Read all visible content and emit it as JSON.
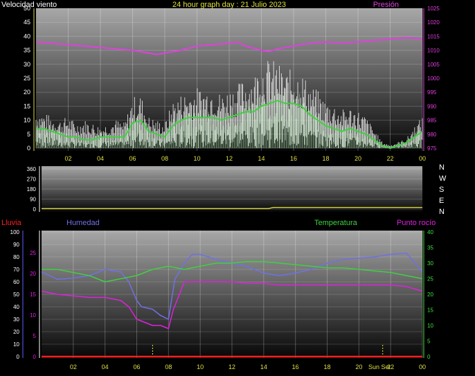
{
  "title": "24 hour graph day : 21 Julio 2023",
  "colors": {
    "background": "#000000",
    "wind_speed": "#ffffff",
    "wind_avg": "#40d040",
    "wind_low": "#c8ffc8",
    "pressure": "#e040e0",
    "direction": "#d0d040",
    "humidity": "#7070e8",
    "temperature": "#40d040",
    "dewpoint": "#e020e0",
    "rain": "#ff2020",
    "axis_yellow": "#e0e040",
    "axis_white": "#ffffff",
    "rain_axis": "#6060ff",
    "axis_green": "#40e040"
  },
  "chart_data": [
    {
      "type": "line",
      "name": "wind-pressure",
      "labels": {
        "left": "Velocidad viento",
        "right": "Presión"
      },
      "x_ticks": [
        "02",
        "04",
        "06",
        "08",
        "10",
        "12",
        "14",
        "16",
        "18",
        "20",
        "22",
        "00"
      ],
      "x_tick_hours": [
        2,
        4,
        6,
        8,
        10,
        12,
        14,
        16,
        18,
        20,
        22,
        24
      ],
      "y_left_ticks": [
        "50",
        "45",
        "40",
        "35",
        "30",
        "25",
        "20",
        "15",
        "10",
        "5",
        "0"
      ],
      "y_left_range": [
        0,
        50
      ],
      "y_right_ticks": [
        "1025",
        "1020",
        "1015",
        "1010",
        "1005",
        "1000",
        "995",
        "990",
        "985",
        "980",
        "975"
      ],
      "y_right_range": [
        975,
        1025
      ],
      "series": [
        {
          "key": "wind_gust",
          "color_key": "wind_speed",
          "x": [
            0,
            0.5,
            1,
            1.5,
            2,
            2.5,
            3,
            3.5,
            4,
            4.5,
            5,
            5.5,
            6,
            6.5,
            7,
            7.5,
            8,
            8.5,
            9,
            9.5,
            10,
            10.5,
            11,
            11.5,
            12,
            12.5,
            13,
            13.5,
            14,
            14.5,
            15,
            15.5,
            16,
            16.5,
            17,
            17.5,
            18,
            18.5,
            19,
            19.5,
            20,
            20.5,
            21,
            21.5,
            22,
            22.5,
            23,
            23.5,
            24
          ],
          "y": [
            12,
            11,
            10,
            9,
            10,
            8,
            9,
            8,
            7,
            8,
            9,
            8,
            16,
            17,
            10,
            9,
            8,
            15,
            17,
            18,
            19,
            19,
            20,
            17,
            19,
            20,
            22,
            23,
            27,
            28,
            27,
            24,
            25,
            24,
            20,
            18,
            15,
            14,
            12,
            13,
            12,
            10,
            6,
            2,
            1,
            2,
            3,
            7,
            10
          ]
        },
        {
          "key": "wind_avg",
          "color_key": "wind_avg",
          "x": [
            0,
            0.5,
            1,
            1.5,
            2,
            2.5,
            3,
            3.5,
            4,
            4.5,
            5,
            5.5,
            6,
            6.5,
            7,
            7.5,
            8,
            8.5,
            9,
            9.5,
            10,
            10.5,
            11,
            11.5,
            12,
            12.5,
            13,
            13.5,
            14,
            14.5,
            15,
            15.5,
            16,
            16.5,
            17,
            17.5,
            18,
            18.5,
            19,
            19.5,
            20,
            20.5,
            21,
            21.5,
            22,
            22.5,
            23,
            23.5,
            24
          ],
          "y": [
            7,
            7,
            6,
            5,
            4,
            4,
            3,
            3,
            4,
            4,
            4,
            4,
            9,
            10,
            6,
            5,
            4,
            8,
            10,
            11,
            11,
            11,
            11,
            10,
            11,
            12,
            13,
            13,
            15,
            16,
            17,
            16,
            16,
            15,
            12,
            10,
            8,
            7,
            6,
            7,
            6,
            5,
            3,
            1,
            0,
            1,
            2,
            4,
            6
          ]
        },
        {
          "key": "pressure",
          "color_key": "pressure",
          "x": [
            0,
            1,
            2,
            3,
            4,
            5,
            6,
            7,
            7.5,
            8,
            9,
            10,
            11,
            12,
            12.5,
            13,
            14,
            14.5,
            15,
            16,
            17,
            18,
            19,
            20,
            21,
            22,
            23,
            24
          ],
          "y": [
            1013,
            1012.5,
            1012,
            1011.5,
            1011,
            1010.5,
            1010,
            1009,
            1008.5,
            1009,
            1010,
            1011.5,
            1012,
            1012.5,
            1013,
            1011.5,
            1010,
            1009.5,
            1010.5,
            1011.5,
            1012.5,
            1013,
            1012.5,
            1013,
            1013.5,
            1014,
            1014.5,
            1014
          ]
        }
      ]
    },
    {
      "type": "line",
      "name": "wind-direction",
      "y_ticks": [
        "360",
        "270",
        "180",
        "90",
        "0"
      ],
      "y_range": [
        0,
        360
      ],
      "dir_labels": [
        "N",
        "W",
        "S",
        "E",
        "N"
      ],
      "series": [
        {
          "key": "direction",
          "color_key": "direction",
          "x": [
            0,
            14.3,
            14.6,
            24
          ],
          "y": [
            5,
            5,
            15,
            15
          ]
        }
      ]
    },
    {
      "type": "line",
      "name": "humidity-temperature",
      "labels": {
        "rain": "Lluvia",
        "humidity": "Humedad",
        "temperature": "Temperatura",
        "dewpoint": "Punto rocío"
      },
      "x_ticks": [
        "02",
        "04",
        "06",
        "08",
        "10",
        "12",
        "14",
        "16",
        "18",
        "20",
        "22",
        "00"
      ],
      "x_tick_hours": [
        2,
        4,
        6,
        8,
        10,
        12,
        14,
        16,
        18,
        20,
        22,
        24
      ],
      "annotation": {
        "text": "Sun Set",
        "hour": 21.5
      },
      "event_marker_hours": [
        7,
        21.5
      ],
      "y_left_outer_ticks": [
        "100",
        "90",
        "80",
        "70",
        "60",
        "50",
        "40",
        "30",
        "20",
        "10",
        "0"
      ],
      "y_left_outer_range": [
        0,
        100
      ],
      "y_left_inner_ticks": [
        "25",
        "20",
        "15",
        "10",
        "5",
        "0"
      ],
      "y_left_inner_range": [
        0,
        30
      ],
      "y_right_ticks": [
        "40",
        "35",
        "30",
        "25",
        "20",
        "15",
        "10",
        "5",
        "0"
      ],
      "y_right_range": [
        0,
        40
      ],
      "series": [
        {
          "key": "humidity",
          "color_key": "humidity",
          "axis": "outer",
          "x": [
            0,
            0.5,
            1,
            2,
            3,
            4,
            5,
            5.5,
            6,
            6.3,
            7,
            7.5,
            8,
            8.4,
            9,
            9.5,
            10,
            11,
            12,
            13,
            14,
            15,
            16,
            17,
            18,
            19,
            20,
            21,
            22,
            23,
            24
          ],
          "y": [
            68,
            65,
            62,
            63,
            65,
            70,
            68,
            60,
            45,
            40,
            38,
            33,
            30,
            62,
            75,
            82,
            82,
            78,
            75,
            72,
            67,
            65,
            67,
            70,
            75,
            78,
            79,
            80,
            82,
            83,
            68
          ]
        },
        {
          "key": "temperature",
          "color_key": "temperature",
          "axis": "right",
          "x": [
            0,
            1,
            2,
            3,
            4,
            5,
            6,
            7,
            8,
            9,
            10,
            11,
            12,
            13,
            14,
            15,
            16,
            17,
            18,
            19,
            20,
            21,
            22,
            23,
            24
          ],
          "y": [
            28,
            28,
            27,
            26,
            24,
            25,
            26,
            28,
            29,
            28,
            29,
            30,
            30,
            30.5,
            30.5,
            30,
            29.5,
            29,
            28.5,
            28.5,
            28,
            27.5,
            27,
            26,
            25
          ]
        },
        {
          "key": "dewpoint",
          "color_key": "dewpoint",
          "axis": "right",
          "x": [
            0,
            1,
            2,
            3,
            4,
            5,
            5.5,
            6,
            7,
            7.5,
            8,
            8.3,
            9,
            10,
            11,
            12,
            13,
            14,
            15,
            16,
            17,
            18,
            19,
            20,
            21,
            22,
            23,
            24
          ],
          "y": [
            21,
            20,
            19.5,
            19,
            19,
            18,
            16,
            12,
            10,
            10,
            9,
            15,
            24,
            24,
            24,
            24,
            23.5,
            23.5,
            23,
            23,
            23,
            23,
            23,
            23,
            23,
            23,
            22.5,
            21
          ]
        },
        {
          "key": "rain",
          "color_key": "rain",
          "axis": "outer",
          "x": [
            0,
            24
          ],
          "y": [
            0,
            0
          ]
        }
      ]
    }
  ]
}
